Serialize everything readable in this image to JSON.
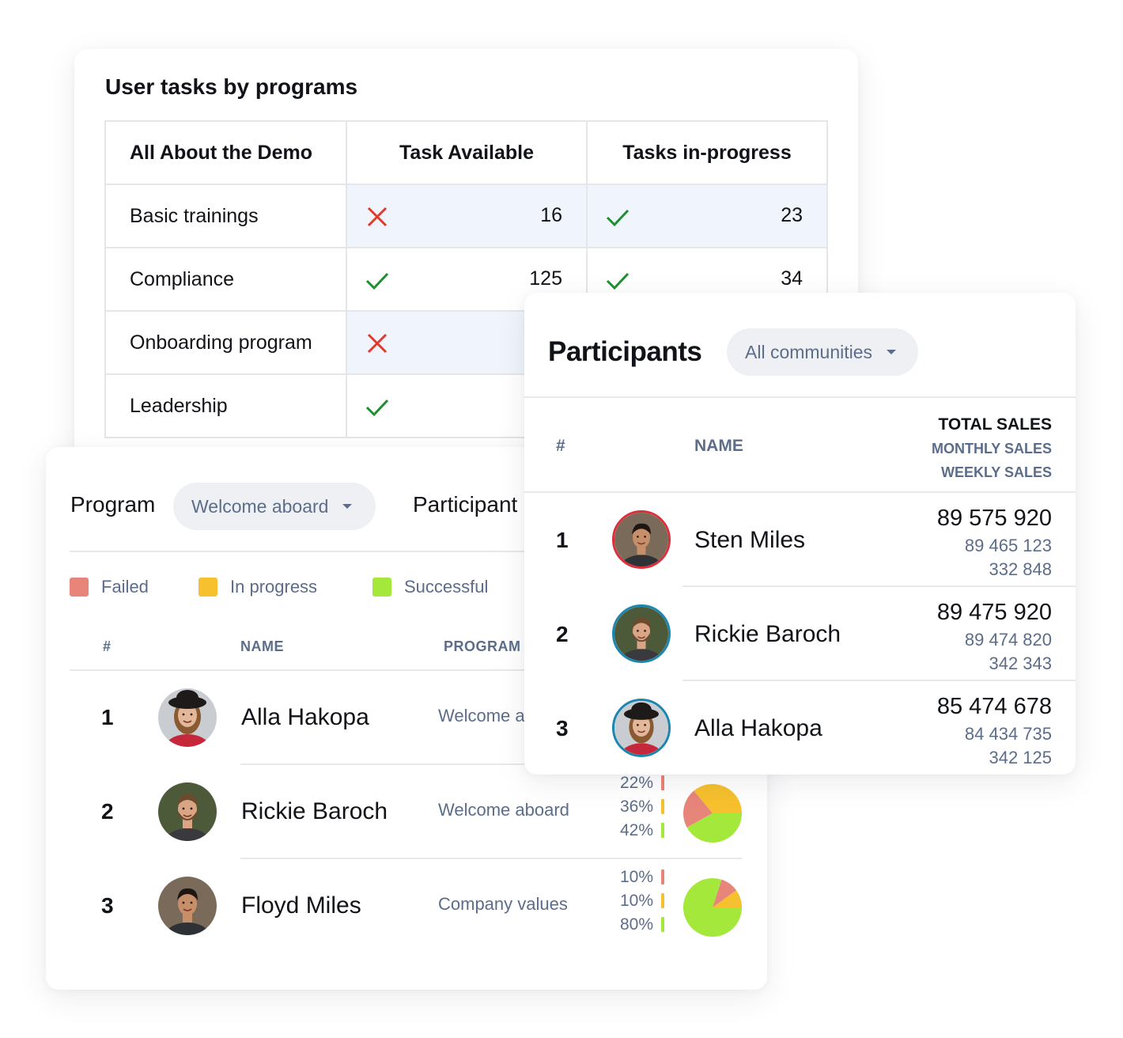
{
  "tasks_card": {
    "title": "User tasks by programs",
    "columns": [
      "All About the Demo",
      "Task Available",
      "Tasks in-progress"
    ],
    "rows": [
      {
        "program": "Basic trainings",
        "available": {
          "status": "cross",
          "count": "16"
        },
        "in_progress": {
          "status": "check",
          "count": "23"
        }
      },
      {
        "program": "Compliance",
        "available": {
          "status": "check",
          "count": "125"
        },
        "in_progress": {
          "status": "check",
          "count": "34"
        }
      },
      {
        "program": "Onboarding program",
        "available": {
          "status": "cross",
          "count": ""
        },
        "in_progress": {
          "status": "",
          "count": ""
        }
      },
      {
        "program": "Leadership",
        "available": {
          "status": "check",
          "count": ""
        },
        "in_progress": {
          "status": "",
          "count": ""
        }
      }
    ],
    "icons": {
      "check": "check-icon",
      "cross": "cross-icon"
    },
    "colors": {
      "check": "#1e8f2e",
      "cross": "#e0392b",
      "shade": "#f0f4fc"
    }
  },
  "program_card": {
    "program_label": "Program",
    "program_dropdown": "Welcome aboard",
    "participant_label": "Participant",
    "legend": [
      {
        "label": "Failed",
        "color": "#e8857b"
      },
      {
        "label": "In progress",
        "color": "#f6c02e"
      },
      {
        "label": "Successful",
        "color": "#a3e83a"
      }
    ],
    "columns": {
      "index": "#",
      "name": "NAME",
      "program": "PROGRAM"
    },
    "rows": [
      {
        "index": "1",
        "name": "Alla Hakopa",
        "program": "Welcome aboard",
        "avatar": "avatar-woman-hat",
        "pcts": [],
        "pie": []
      },
      {
        "index": "2",
        "name": "Rickie Baroch",
        "program": "Welcome aboard",
        "avatar": "avatar-man-beard",
        "pcts": [
          "22%",
          "36%",
          "42%"
        ],
        "pie": [
          22,
          36,
          42
        ]
      },
      {
        "index": "3",
        "name": "Floyd Miles",
        "program": "Company values",
        "avatar": "avatar-man-smiling",
        "pcts": [
          "10%",
          "10%",
          "80%"
        ],
        "pie": [
          10,
          10,
          80
        ]
      }
    ]
  },
  "participants_card": {
    "title": "Participants",
    "community_dropdown": "All communities",
    "columns": {
      "index": "#",
      "name": "NAME",
      "total": "TOTAL SALES",
      "monthly": "MONTHLY SALES",
      "weekly": "WEEKLY SALES"
    },
    "rows": [
      {
        "index": "1",
        "name": "Sten Miles",
        "total": "89 575 920",
        "monthly": "89 465 123",
        "weekly": "332 848",
        "avatar": "avatar-man-smiling",
        "ring": "#d9303c"
      },
      {
        "index": "2",
        "name": "Rickie Baroch",
        "total": "89 475 920",
        "monthly": "89 474 820",
        "weekly": "342 343",
        "avatar": "avatar-man-beard",
        "ring": "#1b86b0"
      },
      {
        "index": "3",
        "name": "Alla Hakopa",
        "total": "85 474 678",
        "monthly": "84 434 735",
        "weekly": "342 125",
        "avatar": "avatar-woman-hat",
        "ring": "#1b86b0"
      }
    ]
  }
}
